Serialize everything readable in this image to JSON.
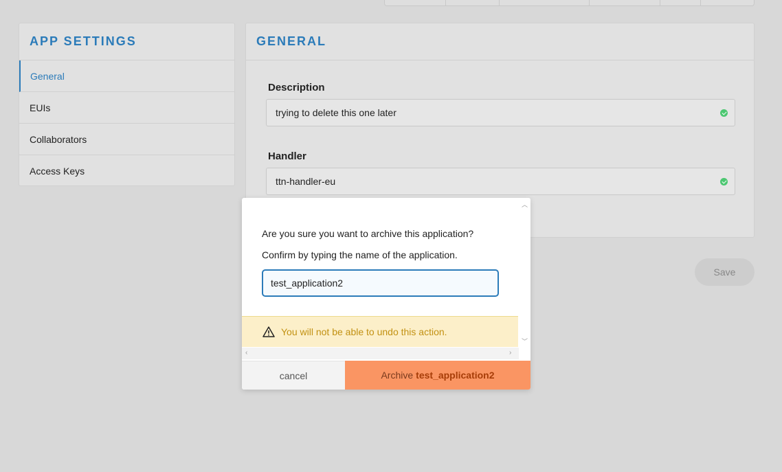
{
  "sidebar": {
    "title": "APP SETTINGS",
    "items": [
      {
        "label": "General",
        "active": true
      },
      {
        "label": "EUIs"
      },
      {
        "label": "Collaborators"
      },
      {
        "label": "Access Keys"
      }
    ]
  },
  "main": {
    "title": "GENERAL",
    "description": {
      "label": "Description",
      "value": "trying to delete this one later"
    },
    "handler": {
      "label": "Handler",
      "value": "ttn-handler-eu"
    },
    "save_label": "Save"
  },
  "modal": {
    "question": "Are you sure you want to archive this application?",
    "instruction": "Confirm by typing the name of the application.",
    "input_value": "test_application2",
    "warning": "You will not be able to undo this action.",
    "cancel_label": "cancel",
    "archive_prefix": "Archive",
    "archive_name": "test_application2"
  },
  "colors": {
    "accent": "#2b7bb9",
    "danger_button": "#fa9563",
    "warning_bg": "#fcefc9",
    "warning_text": "#c29112",
    "valid_check": "#4cc771"
  }
}
